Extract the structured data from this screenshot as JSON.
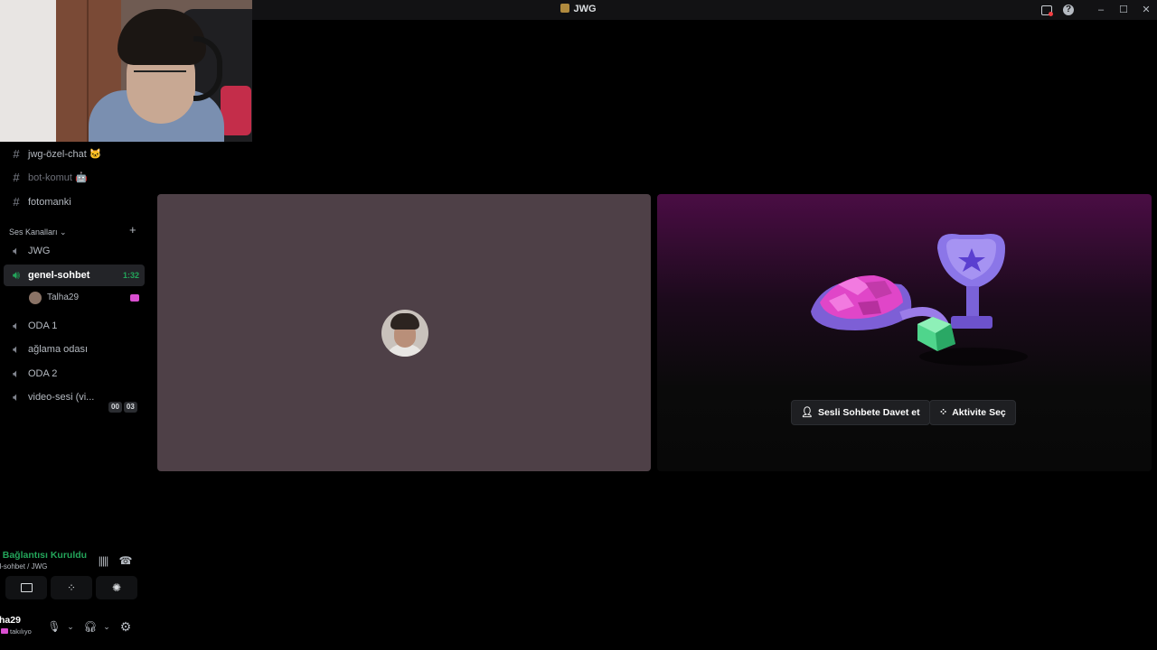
{
  "window": {
    "title": "JWG",
    "controls": {
      "minimize": "–",
      "maximize": "☐",
      "close": "✕"
    }
  },
  "sidebar": {
    "text_channels": [
      {
        "name": "jwg-özel-chat 🐱",
        "icon": "hash-icon",
        "muted": false
      },
      {
        "name": "bot-komut 🤖",
        "icon": "hash-icon",
        "muted": true
      },
      {
        "name": "fotomanki",
        "icon": "hash-icon",
        "muted": false
      }
    ],
    "voice_category": {
      "label": "Ses Kanalları ⌄",
      "add": "+"
    },
    "voice_channels": [
      {
        "name": "JWG",
        "icon": "speaker-icon"
      },
      {
        "name": "genel-sohbet",
        "icon": "speaker-icon",
        "active": true,
        "timer": "1:32"
      },
      {
        "name": "ODA 1",
        "icon": "speaker-icon"
      },
      {
        "name": "ağlama odası",
        "icon": "speaker-icon"
      },
      {
        "name": "ODA 2",
        "icon": "speaker-icon"
      },
      {
        "name": "video-sesi (vi...",
        "icon": "speaker-icon",
        "counter": [
          "00",
          "03"
        ]
      }
    ],
    "connected_member": {
      "name": "Talha29"
    }
  },
  "voice_panel": {
    "status": "s Bağlantısı Kuruldu",
    "subtitle": "el-sohbet / JWG",
    "user": {
      "name": "ha29",
      "status": "takılıyo"
    }
  },
  "stage": {
    "buttons": {
      "invite": "Sesli Sohbete Davet et",
      "activity": "Aktivite Seç"
    }
  },
  "colors": {
    "accent_green": "#23a55a",
    "tile_user_bg": "#4e4047",
    "activity_gradient_top": "#4a0d44",
    "badge_pink": "#d94fd0"
  }
}
